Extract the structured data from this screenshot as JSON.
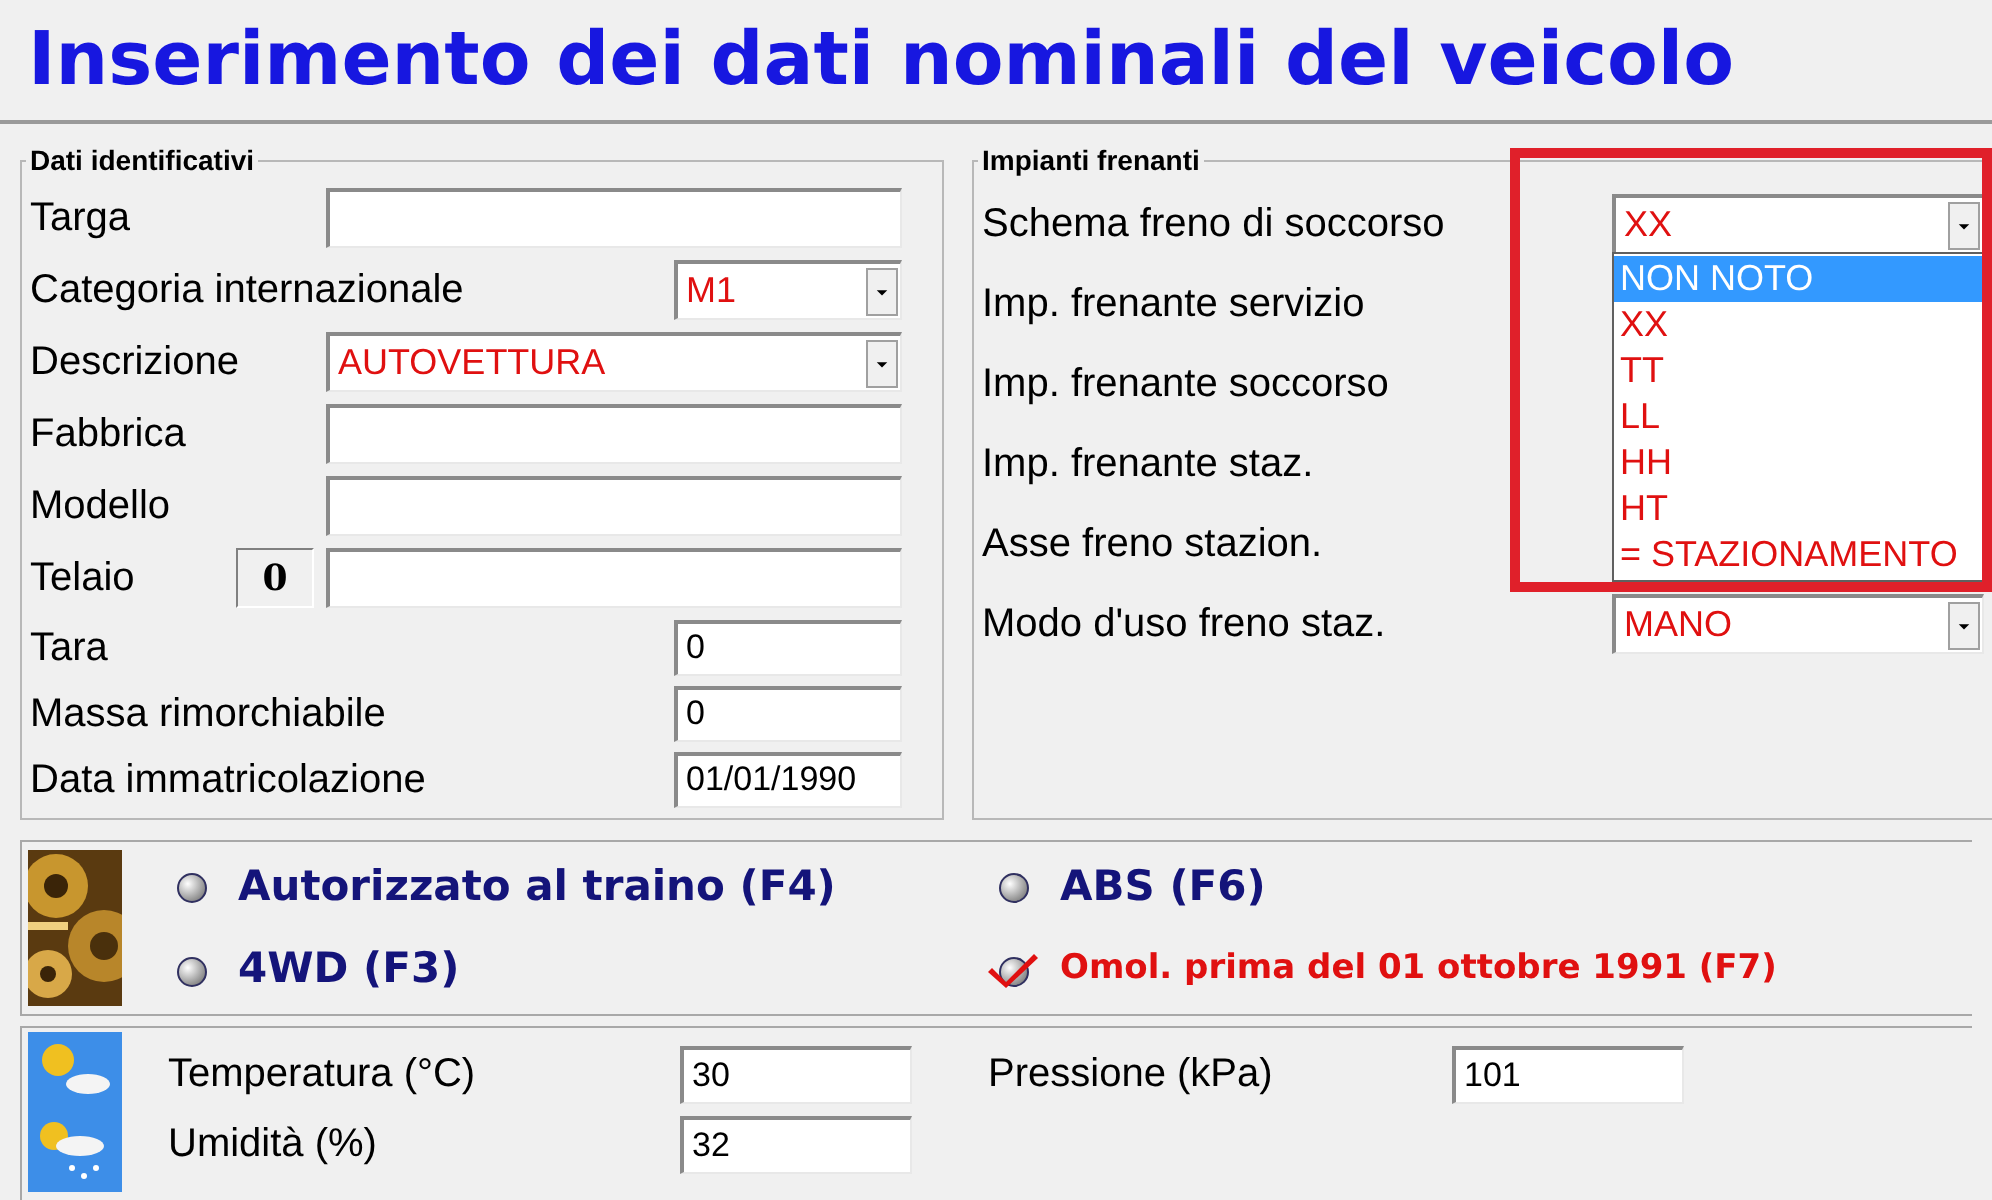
{
  "title": "Inserimento dei dati nominali del veicolo",
  "identification": {
    "legend": "Dati identificativi",
    "rows": [
      {
        "kind": "text",
        "label": "Targa"
      },
      {
        "kind": "combo-short",
        "label": "Categoria internazionale",
        "value": "M1"
      },
      {
        "kind": "combo",
        "label": "Descrizione",
        "value": "AUTOVETTURA"
      },
      {
        "kind": "text",
        "label": "Fabbrica"
      },
      {
        "kind": "text",
        "label": "Modello"
      },
      {
        "kind": "counter-text",
        "label": "Telaio",
        "counter": "0"
      },
      {
        "kind": "short",
        "label": "Tara",
        "value": "0"
      },
      {
        "kind": "short",
        "label": "Massa rimorchiabile",
        "value": "0"
      },
      {
        "kind": "short",
        "label": "Data immatricolazione",
        "value": "01/01/1990"
      }
    ]
  },
  "braking": {
    "legend": "Impianti frenanti",
    "rows": [
      {
        "label": "Schema freno di soccorso",
        "value": "XX"
      },
      {
        "label": "Imp. frenante servizio"
      },
      {
        "label": "Imp. frenante soccorso"
      },
      {
        "label": "Imp. frenante staz."
      },
      {
        "label": "Asse freno stazion."
      },
      {
        "label": "Modo d'uso freno staz.",
        "value": "MANO"
      }
    ],
    "dropdown_list": [
      {
        "label": "NON NOTO",
        "selected": true
      },
      {
        "label": "XX",
        "selected": false
      },
      {
        "label": "TT",
        "selected": false
      },
      {
        "label": "LL",
        "selected": false
      },
      {
        "label": "HH",
        "selected": false
      },
      {
        "label": "HT",
        "selected": false
      },
      {
        "label": "= STAZIONAMENTO",
        "selected": false
      }
    ]
  },
  "options": [
    {
      "label": "Autorizzato al traino (F4)",
      "checked": false
    },
    {
      "label": "ABS (F6)",
      "checked": false
    },
    {
      "label": "4WD (F3)",
      "checked": false
    },
    {
      "label": "Omol. prima del 01 ottobre 1991 (F7)",
      "checked": true
    }
  ],
  "weather": [
    {
      "label": "Temperatura (°C)",
      "value": "30"
    },
    {
      "label": "Pressione (kPa)",
      "value": "101"
    },
    {
      "label": "Umidità (%)",
      "value": "32"
    }
  ]
}
